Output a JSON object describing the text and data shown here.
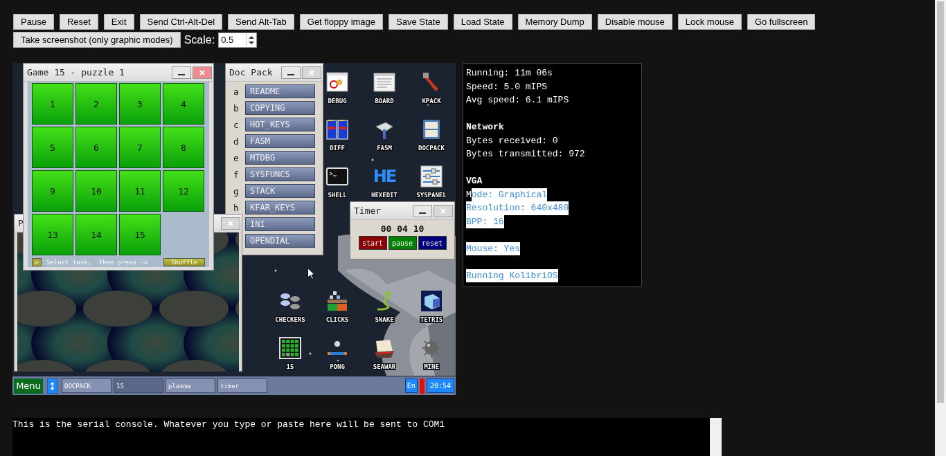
{
  "toolbar": {
    "buttons": [
      "Pause",
      "Reset",
      "Exit",
      "Send Ctrl-Alt-Del",
      "Send Alt-Tab",
      "Get floppy image",
      "Save State",
      "Load State",
      "Memory Dump",
      "Disable mouse",
      "Lock mouse",
      "Go fullscreen",
      "Take screenshot (only graphic modes)"
    ],
    "scale_label": "Scale:",
    "scale_value": "0.5"
  },
  "screen": {
    "docpack": {
      "title": "Doc Pack",
      "items": [
        {
          "letter": "a",
          "label": "README"
        },
        {
          "letter": "b",
          "label": "COPYING"
        },
        {
          "letter": "c",
          "label": "HOT_KEYS"
        },
        {
          "letter": "d",
          "label": "FASM"
        },
        {
          "letter": "e",
          "label": "MTDBG"
        },
        {
          "letter": "f",
          "label": "SYSFUNCS"
        },
        {
          "letter": "g",
          "label": "STACK"
        },
        {
          "letter": "h",
          "label": "KFAR_KEYS"
        },
        {
          "label": "INI"
        },
        {
          "label": "OPENDIAL"
        }
      ]
    },
    "plasma": {
      "title": "P"
    },
    "game15": {
      "title": "Game 15 - puzzle 1",
      "tiles": [
        "1",
        "2",
        "3",
        "4",
        "5",
        "6",
        "7",
        "8",
        "9",
        "10",
        "11",
        "12",
        "13",
        "14",
        "15"
      ],
      "next": ">",
      "hint": "Select task,  then press ->",
      "shuffle": "Shuffle"
    },
    "icon_groups": [
      [
        [
          {
            "label": "DEBUG",
            "kind": "debug"
          },
          {
            "label": "BOARD",
            "kind": "board"
          },
          {
            "label": "KPACK",
            "kind": "wrench"
          }
        ],
        [
          {
            "label": "DIFF",
            "kind": "diff"
          },
          {
            "label": "FASM",
            "kind": "hammer"
          },
          {
            "label": "DOCPACK",
            "kind": "cabinet"
          }
        ],
        [
          {
            "label": "SHELL",
            "kind": "terminal"
          },
          {
            "label": "HEXEDIT",
            "kind": "letters",
            "glyph": "HE"
          },
          {
            "label": "SYSPANEL",
            "kind": "sliders"
          }
        ]
      ],
      [
        [
          {
            "label": "CHECKERS",
            "kind": "checkers"
          },
          {
            "label": "CLICKS",
            "kind": "blocks"
          },
          {
            "label": "SNAKE",
            "kind": "snake"
          },
          {
            "label": "TETRIS",
            "kind": "cube"
          }
        ],
        [
          {
            "label": "15",
            "kind": "grid"
          },
          {
            "label": "PONG",
            "kind": "pong"
          },
          {
            "label": "SEAWAR",
            "kind": "ship"
          },
          {
            "label": "MINE",
            "kind": "mine"
          }
        ]
      ]
    ],
    "timer": {
      "title": "Timer",
      "time": "00 04 10",
      "buttons": [
        {
          "label": "start",
          "color": "#8b0000"
        },
        {
          "label": "pause",
          "color": "#008000"
        },
        {
          "label": "reset",
          "color": "#000080"
        }
      ]
    },
    "taskbar": {
      "menu": "Menu",
      "tasks": [
        {
          "label": "DOCPACK",
          "selected": false
        },
        {
          "label": "15",
          "selected": true
        },
        {
          "label": "plasma",
          "selected": false
        },
        {
          "label": "timer",
          "selected": false
        }
      ],
      "language": "En",
      "clock": "20:54"
    }
  },
  "stats": {
    "sections": [
      {
        "lines": [
          {
            "parts": [
              {
                "text": "Running: 11m 06s",
                "selected": false
              }
            ]
          },
          {
            "parts": [
              {
                "text": "Speed: 5.0 mIPS",
                "selected": false
              }
            ]
          },
          {
            "parts": [
              {
                "text": "Avg speed: 6.1 mIPS",
                "selected": false
              }
            ]
          }
        ]
      },
      {
        "heading": "Network",
        "lines": [
          {
            "parts": [
              {
                "text": "Bytes received: 0",
                "selected": false
              }
            ]
          },
          {
            "parts": [
              {
                "text": "Bytes transmitted: 972",
                "selected": false
              }
            ]
          }
        ]
      },
      {
        "heading": "VGA",
        "lines": [
          {
            "parts": [
              {
                "text": "M",
                "selected": false
              },
              {
                "text": "ode: Graphical",
                "selected": true
              }
            ]
          },
          {
            "parts": [
              {
                "text": "Resolution: 640x480",
                "selected": true
              }
            ]
          },
          {
            "parts": [
              {
                "text": "BPP: 16",
                "selected": true
              }
            ]
          }
        ]
      },
      {
        "lines": [
          {
            "parts": [
              {
                "text": "Mouse: Yes",
                "selected": true
              }
            ]
          }
        ]
      },
      {
        "lines": [
          {
            "parts": [
              {
                "text": "Running KolibriOS",
                "selected": true
              }
            ]
          }
        ]
      }
    ]
  },
  "serial_console": {
    "text": "This is the serial console. Whatever you type or paste here will be sent to COM1"
  }
}
